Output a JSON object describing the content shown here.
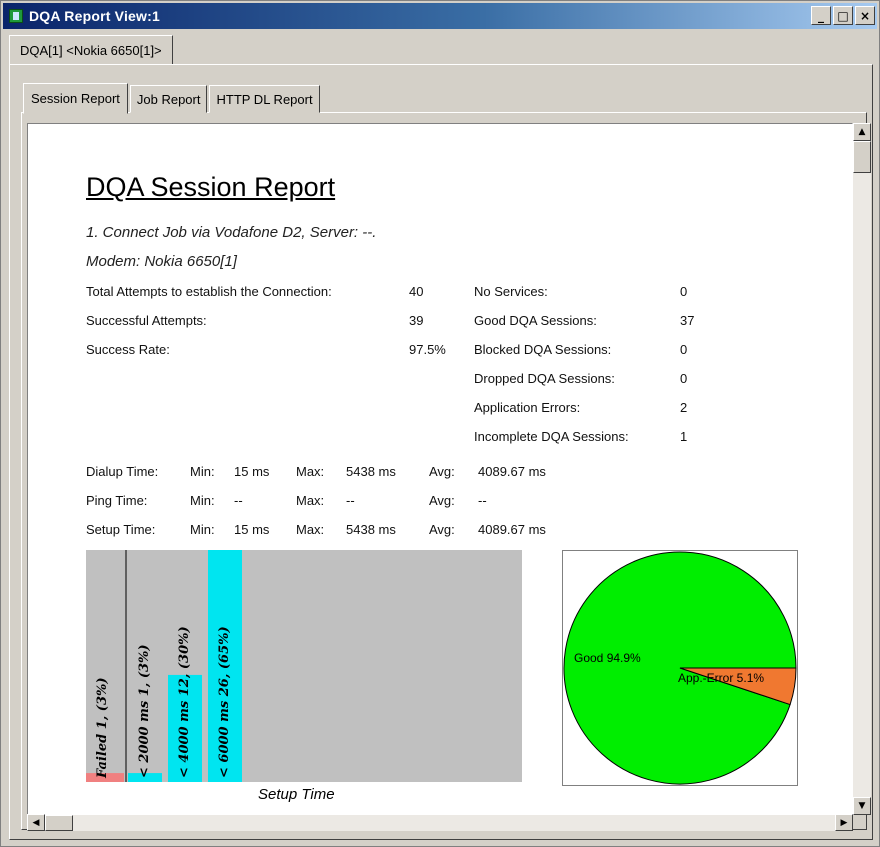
{
  "window": {
    "title": "DQA Report View:1",
    "buttons": {
      "minimize": "_",
      "maximize": "□",
      "close": "×"
    }
  },
  "doc_tab": "DQA[1] <Nokia 6650[1]>",
  "report_tabs": [
    "Session Report",
    "Job Report",
    "HTTP DL Report"
  ],
  "report": {
    "title": "DQA Session Report",
    "subtitle1": "1. Connect Job via Vodafone D2, Server: --.",
    "subtitle2": "Modem: Nokia 6650[1]",
    "left_stats": [
      {
        "label": "Total Attempts to establish the Connection:",
        "value": "40"
      },
      {
        "label": "Successful Attempts:",
        "value": "39"
      },
      {
        "label": "Success Rate:",
        "value": "97.5%"
      }
    ],
    "right_stats": [
      {
        "label": "No Services:",
        "value": "0"
      },
      {
        "label": "Good DQA Sessions:",
        "value": "37"
      },
      {
        "label": "Blocked DQA Sessions:",
        "value": "0"
      },
      {
        "label": "Dropped DQA Sessions:",
        "value": "0"
      },
      {
        "label": "Application Errors:",
        "value": "2"
      },
      {
        "label": "Incomplete DQA Sessions:",
        "value": "1"
      }
    ],
    "timing": [
      {
        "label": "Dialup Time:",
        "min_label": "Min:",
        "min": "15 ms",
        "max_label": "Max:",
        "max": "5438 ms",
        "avg_label": "Avg:",
        "avg": "4089.67 ms"
      },
      {
        "label": "Ping Time:",
        "min_label": "Min:",
        "min": "--",
        "max_label": "Max:",
        "max": "--",
        "avg_label": "Avg:",
        "avg": "--"
      },
      {
        "label": "Setup Time:",
        "min_label": "Min:",
        "min": "15 ms",
        "max_label": "Max:",
        "max": "5438 ms",
        "avg_label": "Avg:",
        "avg": "4089.67 ms"
      }
    ]
  },
  "chart_data": [
    {
      "type": "bar",
      "xlabel": "Setup Time",
      "categories": [
        "Failed",
        "< 2000 ms",
        "< 4000 ms",
        "< 6000 ms"
      ],
      "values": [
        1,
        1,
        12,
        26
      ],
      "percent_labels": [
        "(3%)",
        "(3%)",
        "(30%)",
        "(65%)"
      ],
      "bar_labels": [
        "Failed 1, (3%)",
        "< 2000 ms 1, (3%)",
        "< 4000 ms 12, (30%)",
        "< 6000 ms 26, (65%)"
      ],
      "colors": [
        "#f08080",
        "#00e5f0",
        "#00e5f0",
        "#00e5f0"
      ],
      "ylim": [
        0,
        26
      ],
      "background": "#c0c0c0"
    },
    {
      "type": "pie",
      "slices": [
        {
          "label": "Good 94.9%",
          "value": 94.9,
          "color": "#00ee00"
        },
        {
          "label": "App.-Error 5.1%",
          "value": 5.1,
          "color": "#f07830"
        }
      ]
    }
  ]
}
